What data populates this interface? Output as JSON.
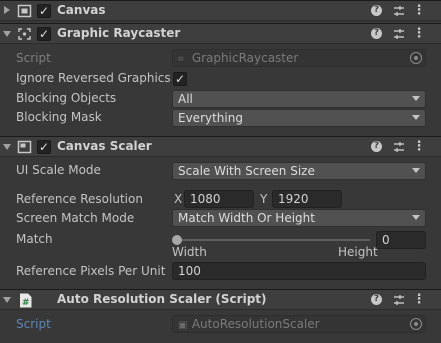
{
  "canvas": {
    "title": "Canvas",
    "checked": "✓"
  },
  "graphic_raycaster": {
    "title": "Graphic Raycaster",
    "checked": "✓",
    "script_label": "Script",
    "script_value": "GraphicRaycaster",
    "ignore_reversed_label": "Ignore Reversed Graphics",
    "ignore_reversed_checked": "✓",
    "blocking_objects_label": "Blocking Objects",
    "blocking_objects_value": "All",
    "blocking_mask_label": "Blocking Mask",
    "blocking_mask_value": "Everything"
  },
  "canvas_scaler": {
    "title": "Canvas Scaler",
    "checked": "✓",
    "ui_scale_mode_label": "UI Scale Mode",
    "ui_scale_mode_value": "Scale With Screen Size",
    "reference_resolution_label": "Reference Resolution",
    "x_label": "X",
    "x_value": "1080",
    "y_label": "Y",
    "y_value": "1920",
    "screen_match_mode_label": "Screen Match Mode",
    "screen_match_mode_value": "Match Width Or Height",
    "match_label": "Match",
    "match_value": "0",
    "match_level": 0,
    "width_label": "Width",
    "height_label": "Height",
    "ref_pixels_label": "Reference Pixels Per Unit",
    "ref_pixels_value": "100"
  },
  "auto_resolution_scaler": {
    "title": "Auto Resolution Scaler (Script)",
    "script_label": "Script",
    "script_value": "AutoResolutionScaler"
  },
  "icons": [
    "foldout-arrow-icon",
    "canvas-icon",
    "raycaster-icon",
    "canvas-scaler-icon",
    "csharp-script-icon",
    "help-icon",
    "preset-icon",
    "kebab-menu-icon",
    "object-picker-icon",
    "script-asset-icon"
  ],
  "colors": {
    "background": "#383838",
    "header": "#3e3e3e",
    "field": "#2a2a2a",
    "dropdown": "#515151",
    "script_label": "#5f86b6"
  }
}
